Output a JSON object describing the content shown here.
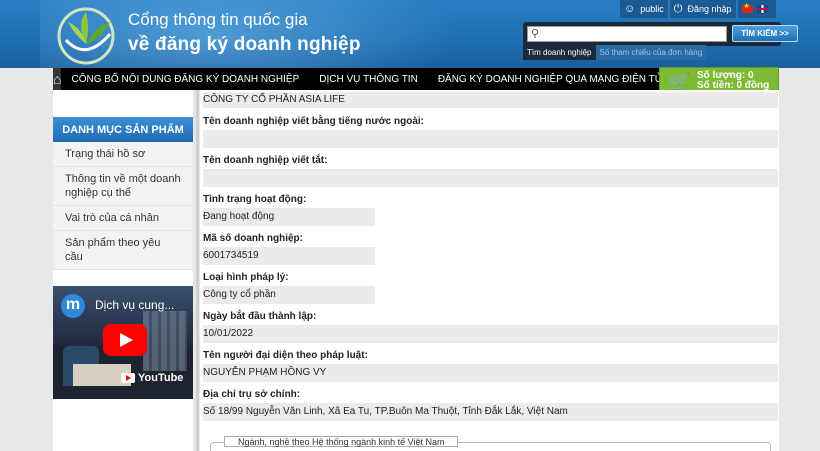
{
  "header": {
    "title_line1": "Cổng thông tin quốc gia",
    "title_line2": "về đăng ký doanh nghiệp",
    "user_label": "public",
    "login_label": "Đăng nhập"
  },
  "search": {
    "placeholder": "",
    "button_label": "TÌM KIẾM >>",
    "tabs": [
      "Tìm doanh nghiệp",
      "Số tham chiếu của đơn hàng"
    ]
  },
  "nav": {
    "items": [
      "CÔNG BỐ NỘI DUNG ĐĂNG KÝ DOANH NGHIỆP",
      "DỊCH VỤ THÔNG TIN",
      "ĐĂNG KÝ DOANH NGHIỆP QUA MẠNG ĐIỆN TỬ"
    ]
  },
  "cart": {
    "quantity_label": "Số lượng: 0",
    "amount_label": "Số tiền: 0 đồng"
  },
  "sidebar": {
    "heading": "DANH MỤC SẢN PHẨM",
    "items": [
      "Trạng thái hồ sơ",
      "Thông tin về một doanh nghiệp cụ thể",
      "Vai trò của cá nhân",
      "Sản phẩm theo yêu cầu"
    ],
    "video_title": "Dịch vụ cung...",
    "video_brand": "YouTube",
    "video_logo": "m"
  },
  "details": {
    "company_name": "CÔNG TY CỔ PHẦN ASIA LIFE",
    "foreign_name_label": "Tên doanh nghiệp viết bằng tiếng nước ngoài:",
    "foreign_name_value": "",
    "short_name_label": "Tên doanh nghiệp viết tắt:",
    "short_name_value": "",
    "status_label": "Tình trạng hoạt động:",
    "status_value": "Đang hoạt động",
    "tax_code_label": "Mã số doanh nghiệp:",
    "tax_code_value": "6001734519",
    "legal_type_label": "Loại hình pháp lý:",
    "legal_type_value": "Công ty cổ phần",
    "start_date_label": "Ngày bắt đầu thành lập:",
    "start_date_value": "10/01/2022",
    "rep_label": "Tên người đại diện theo pháp luật:",
    "rep_value": "NGUYỄN PHẠM HỒNG VY",
    "address_label": "Địa chỉ trụ sở chính:",
    "address_value": "Số 18/99 Nguyễn Văn Linh, Xã Ea Tu, TP.Buôn Ma Thuột, Tỉnh Đắk Lắk, Việt Nam",
    "industry_legend": "Ngành, nghề theo Hệ thống ngành kinh tế Việt Nam"
  }
}
